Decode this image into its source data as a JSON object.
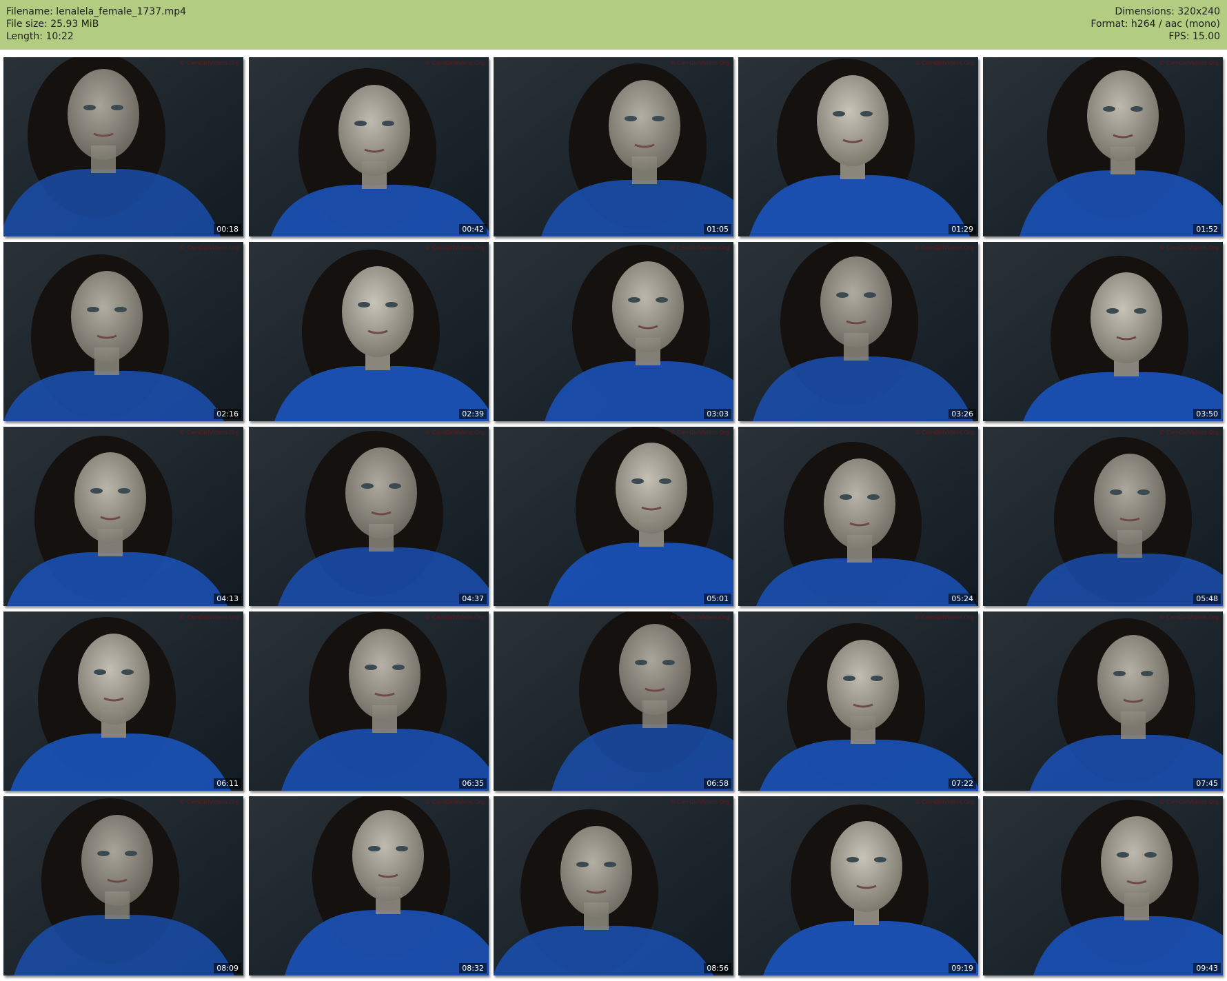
{
  "header": {
    "filename": "Filename: lenalela_female_1737.mp4",
    "filesize": "File size: 25.93 MiB",
    "length": "Length: 10:22",
    "dimensions": "Dimensions: 320x240",
    "format": "Format: h264 / aac (mono)",
    "fps": "FPS: 15.00"
  },
  "colors": {
    "header_background": "#b2cd82",
    "page_background": "#ffffff",
    "shirt_blue": "#1a4fb0",
    "room_dark": "#121a22",
    "watermark_red": "#7a1414"
  },
  "watermark": "© CamGirlVideos.Org",
  "thumbnails": [
    {
      "time": "00:18"
    },
    {
      "time": "00:42"
    },
    {
      "time": "01:05"
    },
    {
      "time": "01:29"
    },
    {
      "time": "01:52"
    },
    {
      "time": "02:16"
    },
    {
      "time": "02:39"
    },
    {
      "time": "03:03"
    },
    {
      "time": "03:26"
    },
    {
      "time": "03:50"
    },
    {
      "time": "04:13"
    },
    {
      "time": "04:37"
    },
    {
      "time": "05:01"
    },
    {
      "time": "05:24"
    },
    {
      "time": "05:48"
    },
    {
      "time": "06:11"
    },
    {
      "time": "06:35"
    },
    {
      "time": "06:58"
    },
    {
      "time": "07:22"
    },
    {
      "time": "07:45"
    },
    {
      "time": "08:09"
    },
    {
      "time": "08:32"
    },
    {
      "time": "08:56"
    },
    {
      "time": "09:19"
    },
    {
      "time": "09:43"
    }
  ]
}
